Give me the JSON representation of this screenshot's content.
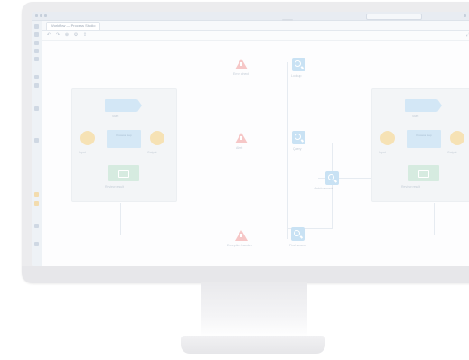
{
  "app": {
    "tab_label": "Workflow — Process Studio",
    "search_placeholder": ""
  },
  "toolbar": {
    "icons": [
      "undo-icon",
      "redo-icon",
      "zoom-icon",
      "settings-icon",
      "share-icon"
    ]
  },
  "diagram": {
    "left_lane": {
      "banner_label": "Start",
      "box_label": "Process step",
      "circle_left_label": "Input",
      "circle_right_label": "Output",
      "green_label": "Review result"
    },
    "right_lane": {
      "banner_label": "Start",
      "box_label": "Process step",
      "circle_left_label": "Input",
      "circle_right_label": "Output",
      "green_label": "Review result"
    },
    "warn_nodes": [
      {
        "label": "Error check"
      },
      {
        "label": "Alert"
      },
      {
        "label": "Exception handler"
      }
    ],
    "search_nodes": [
      {
        "label": "Lookup"
      },
      {
        "label": "Query"
      },
      {
        "label": "Match records"
      },
      {
        "label": "Final search"
      }
    ]
  },
  "colors": {
    "monitor": "#ececee",
    "accent_blue": "#c9e2f4",
    "warn_red": "#f6c7c7",
    "amber": "#f6e2b5",
    "green": "#d6ebe0"
  }
}
